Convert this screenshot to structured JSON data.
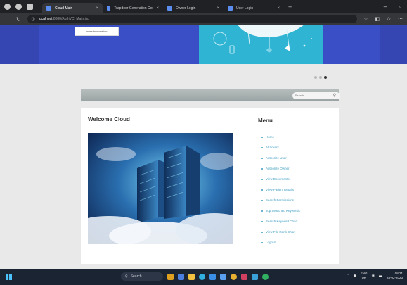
{
  "browser": {
    "tabs": [
      {
        "title": "Cloud Main",
        "active": true,
        "favicon_color": "#5b8def"
      },
      {
        "title": "Trapdoor Generation Centre Logi",
        "active": false,
        "favicon_color": "#5b8def"
      },
      {
        "title": "Owner Login",
        "active": false,
        "favicon_color": "#5b8def"
      },
      {
        "title": "User Login",
        "active": false,
        "favicon_color": "#5b8def"
      }
    ],
    "address_host": "localhost",
    "address_path": ":8080/AuthVC_Main.jsp"
  },
  "banner": {
    "more_info_label": "more information",
    "color": "#3a4fc6"
  },
  "search": {
    "placeholder": "Search..."
  },
  "content": {
    "welcome_title": "Welcome Cloud",
    "menu_title": "Menu",
    "menu_items": [
      "Home",
      "Attackers",
      "Authorize User",
      "Authorize Owner",
      "View Documents",
      "View Patient Details",
      "Search Permissions",
      "Top Searched Keywords",
      "Search Keyword Chart",
      "View File Rank Chart",
      "Logout"
    ],
    "link_color": "#3f9ec1"
  },
  "taskbar": {
    "search_label": "Search",
    "language_line1": "ENG",
    "language_line2": "UK",
    "time": "08:21",
    "date": "28-02-2023"
  }
}
